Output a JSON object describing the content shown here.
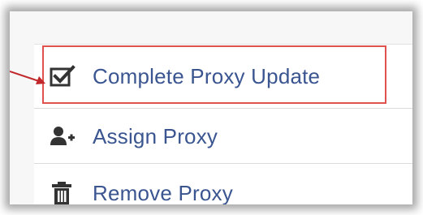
{
  "menu": {
    "items": [
      {
        "label": "Complete Proxy Update",
        "icon": "checkbox-checked-icon"
      },
      {
        "label": "Assign Proxy",
        "icon": "add-user-icon"
      },
      {
        "label": "Remove Proxy",
        "icon": "trash-icon"
      }
    ]
  },
  "colors": {
    "label_text": "#3a5590",
    "icon": "#333333",
    "highlight_border": "#e0524e",
    "arrow": "#c0282b"
  }
}
